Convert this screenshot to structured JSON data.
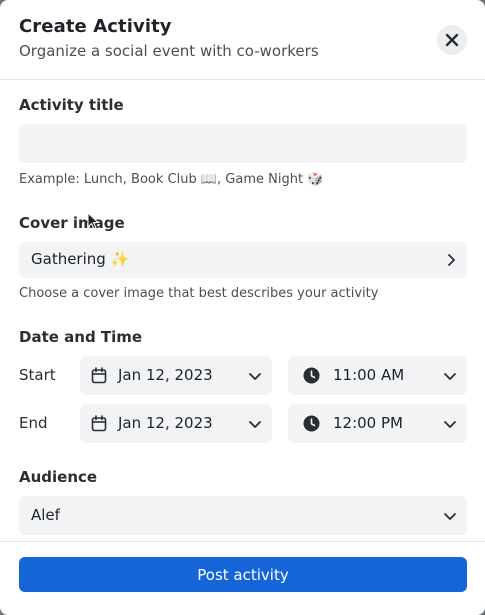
{
  "header": {
    "title": "Create Activity",
    "subtitle": "Organize a social event with co-workers"
  },
  "activity_title": {
    "label": "Activity title",
    "value": "",
    "hint": "Example: Lunch, Book Club 📖, Game Night 🎲"
  },
  "cover_image": {
    "label": "Cover image",
    "value": "Gathering ✨",
    "hint": "Choose a cover image that best describes your activity"
  },
  "date_time": {
    "label": "Date and Time",
    "start": {
      "label": "Start",
      "date": "Jan 12, 2023",
      "time": "11:00 AM"
    },
    "end": {
      "label": "End",
      "date": "Jan 12, 2023",
      "time": "12:00 PM"
    }
  },
  "audience": {
    "label": "Audience",
    "value": "Alef"
  },
  "footer": {
    "post_label": "Post activity"
  },
  "icons": {
    "close": "close-icon",
    "calendar": "calendar-icon",
    "clock": "clock-icon",
    "chevron_down": "chevron-down-icon",
    "chevron_right": "chevron-right-icon"
  },
  "colors": {
    "primary": "#1565d8",
    "field_bg": "#f1f3f5",
    "backdrop": "#6f7378"
  }
}
